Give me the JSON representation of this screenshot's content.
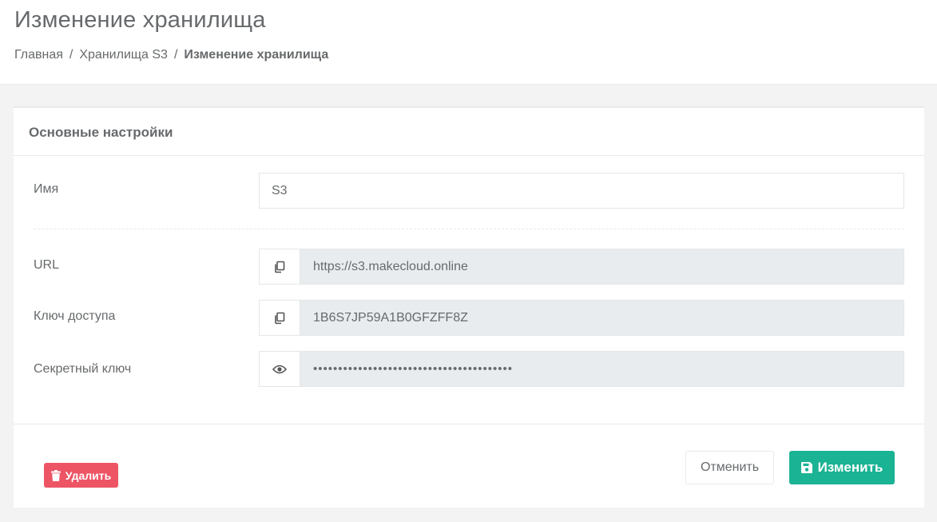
{
  "header": {
    "title": "Изменение хранилища",
    "breadcrumb": [
      "Главная",
      "Хранилища S3",
      "Изменение хранилища"
    ]
  },
  "card": {
    "title": "Основные настройки"
  },
  "form": {
    "name_label": "Имя",
    "name_value": "S3",
    "url_label": "URL",
    "url_value": "https://s3.makecloud.online",
    "access_key_label": "Ключ доступа",
    "access_key_value": "1B6S7JP59A1B0GFZFF8Z",
    "secret_key_label": "Секретный ключ",
    "secret_key_value": "••••••••••••••••••••••••••••••••••••••••"
  },
  "actions": {
    "delete_label": "Удалить",
    "cancel_label": "Отменить",
    "save_label": "Изменить"
  },
  "icons": {
    "url_addon": "copy-icon",
    "access_key_addon": "copy-icon",
    "secret_key_addon": "eye-icon",
    "delete": "trash-icon",
    "save": "floppy-disk-icon"
  },
  "colors": {
    "primary": "#1ab394",
    "danger": "#ed5565",
    "text": "#676a6c",
    "readonly_bg": "#e9ecef"
  }
}
